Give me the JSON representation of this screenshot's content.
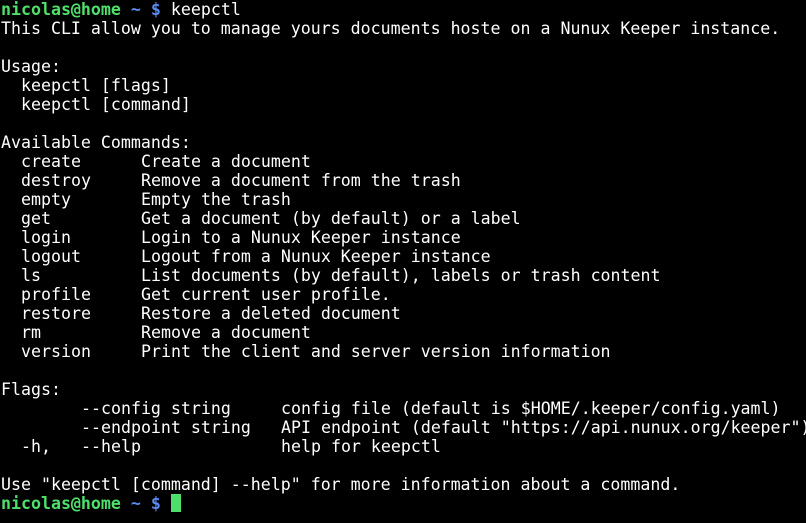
{
  "prompt": {
    "user_host": "nicolas@home",
    "path": "~",
    "symbol": "$"
  },
  "first_command": "keepctl",
  "description": "This CLI allow you to manage yours documents hoste on a Nunux Keeper instance.",
  "usage": {
    "heading": "Usage:",
    "lines": [
      "keepctl [flags]",
      "keepctl [command]"
    ]
  },
  "commands": {
    "heading": "Available Commands:",
    "items": [
      {
        "name": "create",
        "desc": "Create a document"
      },
      {
        "name": "destroy",
        "desc": "Remove a document from the trash"
      },
      {
        "name": "empty",
        "desc": "Empty the trash"
      },
      {
        "name": "get",
        "desc": "Get a document (by default) or a label"
      },
      {
        "name": "login",
        "desc": "Login to a Nunux Keeper instance"
      },
      {
        "name": "logout",
        "desc": "Logout from a Nunux Keeper instance"
      },
      {
        "name": "ls",
        "desc": "List documents (by default), labels or trash content"
      },
      {
        "name": "profile",
        "desc": "Get current user profile."
      },
      {
        "name": "restore",
        "desc": "Restore a deleted document"
      },
      {
        "name": "rm",
        "desc": "Remove a document"
      },
      {
        "name": "version",
        "desc": "Print the client and server version information"
      }
    ]
  },
  "flags": {
    "heading": "Flags:",
    "items": [
      {
        "short": "",
        "name": "--config string",
        "desc": "config file (default is $HOME/.keeper/config.yaml)"
      },
      {
        "short": "",
        "name": "--endpoint string",
        "desc": "API endpoint (default \"https://api.nunux.org/keeper\")"
      },
      {
        "short": "-h,",
        "name": "--help",
        "desc": "help for keepctl"
      }
    ]
  },
  "footer": "Use \"keepctl [command] --help\" for more information about a command.",
  "colors": {
    "background": "#000000",
    "prompt_user": "#4ee06b",
    "prompt_path": "#5b8cf0",
    "cursor": "#4ee06b"
  }
}
